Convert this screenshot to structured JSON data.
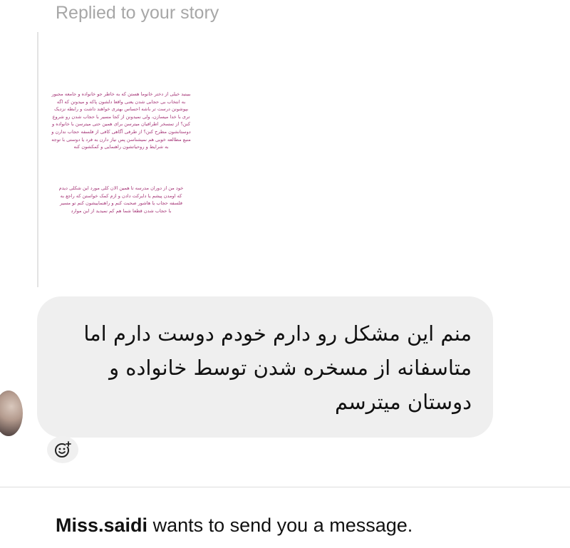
{
  "thread": {
    "replied_label": "Replied to your story"
  },
  "story": {
    "paragraph_1": "ببینید خیلی از دختر خانوما هستن که به خاطر جو خانواده و جامعه مجبور به انتخاب بی حجابی شدن یعنی واقعا دلشون پاکه و میدونن که اگه بپوشونن درست تر باشه احساس بهتری خواهند داشت و رابطه نزدیک تری با خدا میسازن، ولی نمیدونن از کجا مسیر با حجاب شدن رو شروع کنن؟ از تمسخر اطرافیان میترسن برای همین حتی میترسن با خانواده و دوستانشون مطرح کنن؟ از طرفی آگاهی کافی از فلسفه حجاب ندارن و منبع مطالعه خوبی هم نمیشناسن پس نیاز دارن به فرد یا دوستی با توجه به شرایط و روحیاتشون راهنمایی و کمکشون کنه",
    "paragraph_2": "خود من از دوران مدرسه تا همین الان کلی مورد این شکلی دیدم که اومدن پیشم یا دایرکت دادن و ازم کمک خواستن که راجع به فلسفه حجاب یا هاشور صحبت کنم و راهنماییشون کنم تو مسیر با حجاب شدن قطعا شما هم کم نمیدید از این موارد"
  },
  "message": {
    "text": "منم این مشکل رو دارم خودم دوست دارم اما متاسفانه از مسخره شدن توسط خانواده و دوستان میترسم"
  },
  "reaction": {
    "icon": "add-reaction-icon"
  },
  "request": {
    "username": "Miss.saidi",
    "text": " wants to send you a message."
  }
}
